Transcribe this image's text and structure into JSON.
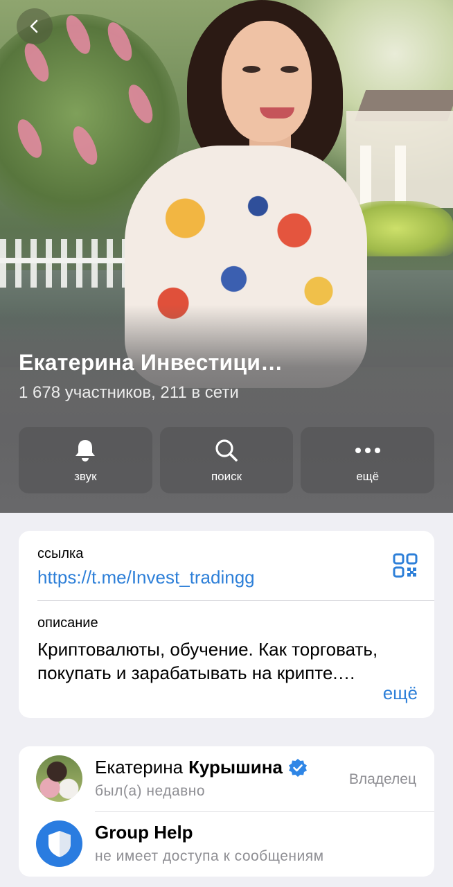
{
  "header": {
    "title": "Екатерина Инвестици…",
    "subtitle": "1 678 участников, 211 в сети"
  },
  "actions": [
    {
      "label": "звук",
      "icon": "bell-icon"
    },
    {
      "label": "поиск",
      "icon": "search-icon"
    },
    {
      "label": "ещё",
      "icon": "more-dots-icon"
    }
  ],
  "info": {
    "link_label": "ссылка",
    "link_value": "https://t.me/Invest_tradingg",
    "description_label": "описание",
    "description_value": "Криптовалюты, обучение. Как торговать, покупать и зарабатывать на крипте.…",
    "more_label": "ещё"
  },
  "members": [
    {
      "name_first": "Екатерина",
      "name_last": "Курышина",
      "verified": true,
      "status": "был(а) недавно",
      "role": "Владелец"
    },
    {
      "name_first": "Group Help",
      "name_last": "",
      "verified": false,
      "status": "не имеет доступа к сообщениям",
      "role": ""
    }
  ],
  "colors": {
    "accent": "#2d7fd8",
    "background": "#efeff4",
    "secondary_text": "#8e8e93",
    "verified_badge": "#2f86e6"
  }
}
